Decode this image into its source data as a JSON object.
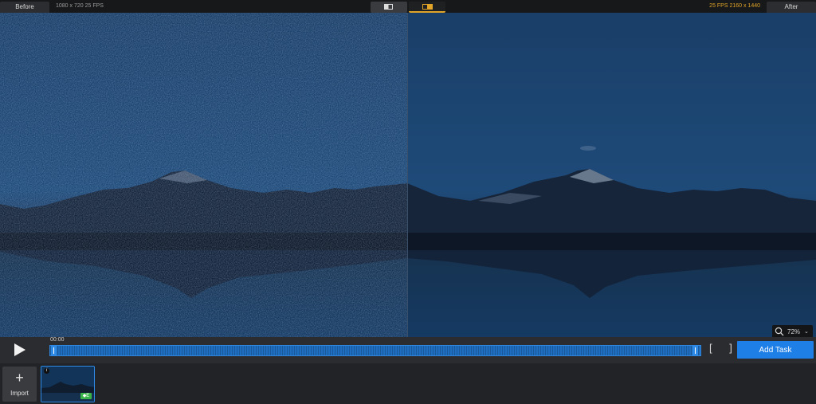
{
  "compare": {
    "before_label": "Before",
    "after_label": "After",
    "before_meta": "1080 x 720  25 FPS",
    "after_meta": "25 FPS  2160 x 1440"
  },
  "view_modes": {
    "split": "split-view-icon",
    "side_by_side": "side-by-side-icon"
  },
  "viewer": {
    "zoom": "72%"
  },
  "timeline": {
    "time": "00:00",
    "brackets": "[ ]",
    "add_task_label": "Add Task"
  },
  "media": {
    "import_label": "Import",
    "thumb_info": "i",
    "thumb_badge": "◆E"
  },
  "colors": {
    "accent": "#1e7fe6",
    "after_highlight": "#e0a528",
    "badge": "#39b44a"
  }
}
